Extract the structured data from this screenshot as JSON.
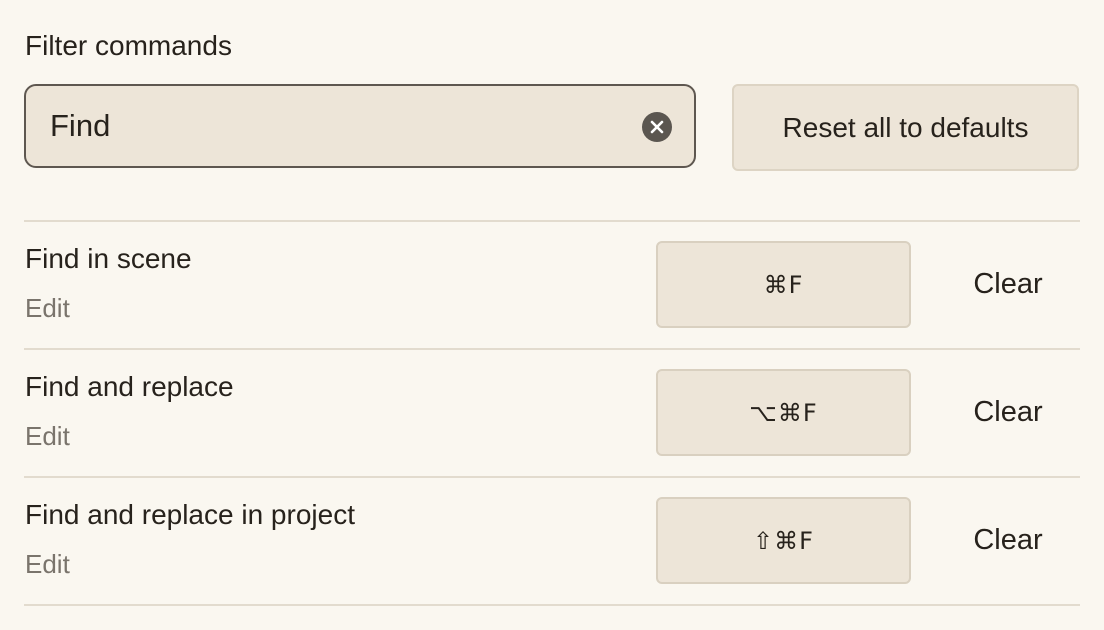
{
  "filter": {
    "label": "Filter commands",
    "value": "Find",
    "clear_icon": "close-circle-icon"
  },
  "reset_button": {
    "label": "Reset all to defaults"
  },
  "commands": [
    {
      "name": "Find in scene",
      "category": "Edit",
      "shortcut": "⌘F",
      "clear_label": "Clear"
    },
    {
      "name": "Find and replace",
      "category": "Edit",
      "shortcut": "⌥⌘F",
      "clear_label": "Clear"
    },
    {
      "name": "Find and replace in project",
      "category": "Edit",
      "shortcut": "⇧⌘F",
      "clear_label": "Clear"
    }
  ],
  "colors": {
    "background": "#faf7f0",
    "field_background": "#ede5d8",
    "field_border": "#5e5750",
    "text": "#27221c",
    "muted_text": "#7a746c",
    "divider": "#e2dbce"
  }
}
